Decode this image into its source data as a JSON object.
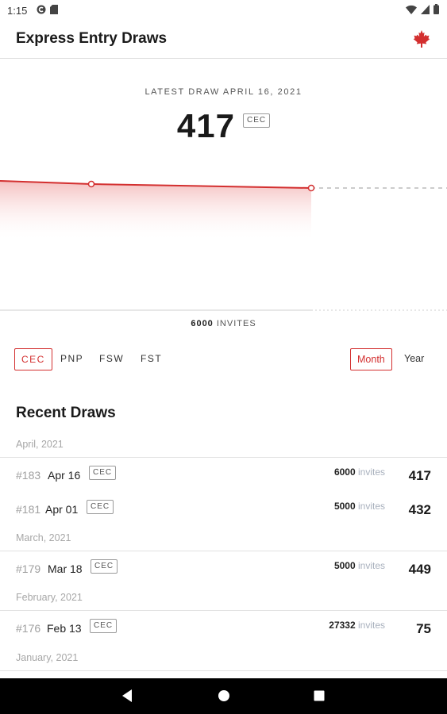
{
  "status_bar": {
    "time": "1:15",
    "icons_left": [
      "c-badge-icon",
      "sd-card-icon"
    ],
    "icons_right": [
      "wifi-icon",
      "signal-icon",
      "battery-icon"
    ]
  },
  "app_bar": {
    "title": "Express Entry Draws",
    "icon": "maple-leaf-icon"
  },
  "latest": {
    "label": "LATEST DRAW APRIL 16, 2021",
    "score": "417",
    "program": "CEC"
  },
  "chart_data": {
    "type": "line",
    "y_values_visible": [
      432,
      417
    ],
    "caption_invites": "6000",
    "caption_suffix": "INVITES",
    "colors": {
      "line": "#d32f2f",
      "fill": "#f4bcbc",
      "dashed": "#bbbbbb"
    }
  },
  "filters": {
    "programs": [
      "CEC",
      "PNP",
      "FSW",
      "FST"
    ],
    "selected_program": "CEC",
    "periods": [
      "Month",
      "Year"
    ],
    "selected_period": "Month"
  },
  "recent": {
    "title": "Recent Draws",
    "groups": [
      {
        "month": "April, 2021",
        "draws": [
          {
            "num": "#183",
            "date": "Apr 16",
            "program": "CEC",
            "invites": "6000",
            "invites_label": "invites",
            "score": "417"
          },
          {
            "num": "#181",
            "date": "Apr 01",
            "program": "CEC",
            "invites": "5000",
            "invites_label": "invites",
            "score": "432"
          }
        ]
      },
      {
        "month": "March, 2021",
        "draws": [
          {
            "num": "#179",
            "date": "Mar 18",
            "program": "CEC",
            "invites": "5000",
            "invites_label": "invites",
            "score": "449"
          }
        ]
      },
      {
        "month": "February, 2021",
        "draws": [
          {
            "num": "#176",
            "date": "Feb 13",
            "program": "CEC",
            "invites": "27332",
            "invites_label": "invites",
            "score": "75"
          }
        ]
      },
      {
        "month": "January, 2021",
        "draws": []
      }
    ]
  },
  "nav_bar": {
    "buttons": [
      "back-icon",
      "home-icon",
      "recents-icon"
    ]
  },
  "colors": {
    "accent": "#d32f2f",
    "muted": "#a7a7a7"
  }
}
